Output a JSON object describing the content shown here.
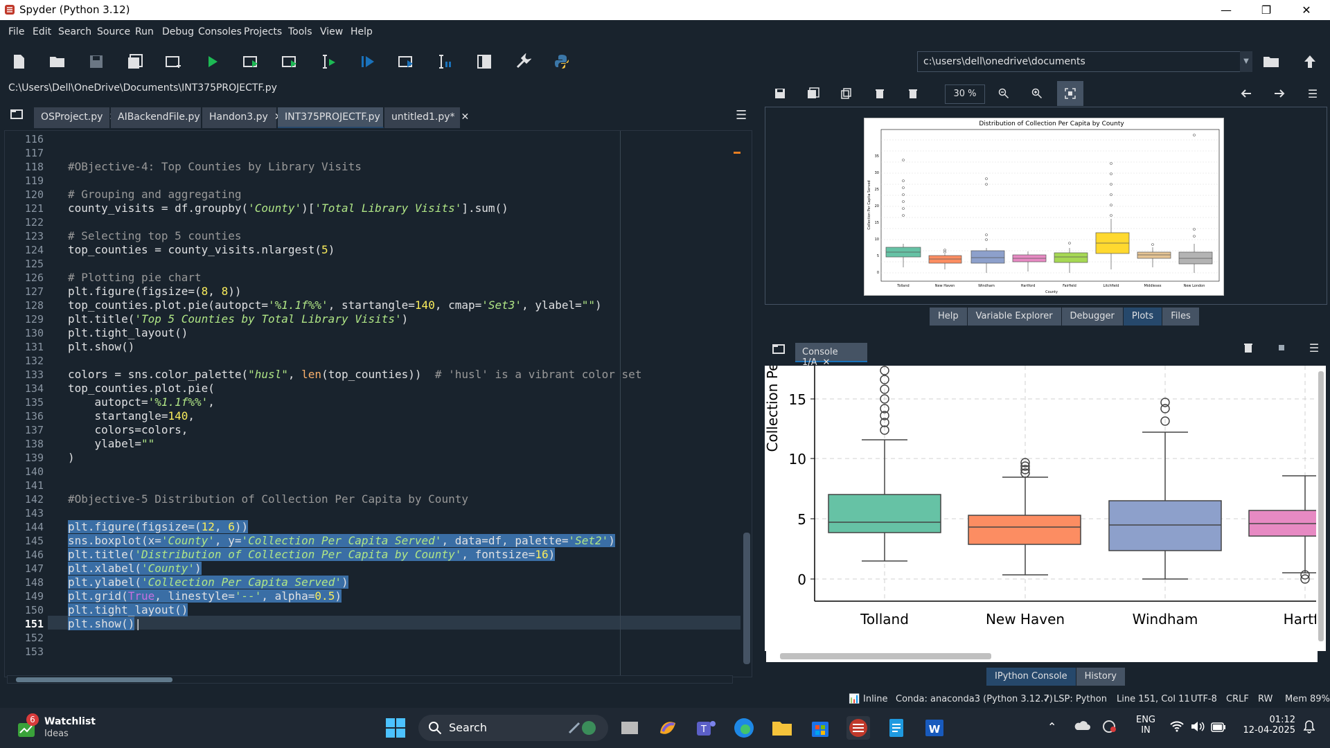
{
  "window": {
    "title": "Spyder (Python 3.12)"
  },
  "menu": [
    "File",
    "Edit",
    "Search",
    "Source",
    "Run",
    "Debug",
    "Consoles",
    "Projects",
    "Tools",
    "View",
    "Help"
  ],
  "toolbar": {
    "path_value": "c:\\users\\dell\\onedrive\\documents"
  },
  "editor": {
    "file_path": "C:\\Users\\Dell\\OneDrive\\Documents\\INT375PROJECTF.py",
    "tabs": [
      "OSProject.py",
      "AIBackendFile.py",
      "Handon3.py",
      "INT375PROJECTF.py",
      "untitled1.py*"
    ],
    "active_tab": 3,
    "line_numbers": [
      "116",
      "117",
      "118",
      "119",
      "120",
      "121",
      "122",
      "123",
      "124",
      "125",
      "126",
      "127",
      "128",
      "129",
      "130",
      "131",
      "132",
      "133",
      "134",
      "135",
      "136",
      "137",
      "138",
      "139",
      "140",
      "141",
      "142",
      "143",
      "144",
      "145",
      "146",
      "147",
      "148",
      "149",
      "150",
      "151",
      "152",
      "153"
    ],
    "current_line": "151"
  },
  "plots": {
    "zoom": "30 %",
    "tabs": [
      "Help",
      "Variable Explorer",
      "Debugger",
      "Plots",
      "Files"
    ],
    "active_tab": "Plots",
    "figure_title": "Distribution of Collection Per Capita by County",
    "x_label": "County",
    "y_label": "Collection Per Capita Served",
    "counties": [
      "Tolland",
      "New Haven",
      "Windham",
      "Hartford",
      "Fairfield",
      "Litchfield",
      "Middlesex",
      "New London"
    ],
    "y_ticks": [
      "0",
      "5",
      "10",
      "15",
      "20",
      "25",
      "30",
      "35"
    ]
  },
  "console": {
    "tab_label": "Console 1/A",
    "y_label": "Collection Pe",
    "y_ticks": [
      "0",
      "5",
      "10",
      "15"
    ],
    "x_ticks": [
      "Tolland",
      "New Haven",
      "Windham",
      "Hartfo"
    ],
    "bottom_tabs": [
      "IPython Console",
      "History"
    ]
  },
  "statusbar": {
    "inline": "Inline",
    "conda": "Conda: anaconda3 (Python 3.12.7)",
    "lsp": "✓ LSP: Python",
    "position": "Line 151, Col 11",
    "encoding": "UTF-8",
    "eol": "CRLF",
    "rw": "RW",
    "mem": "Mem 89%"
  },
  "taskbar": {
    "watchlist": "Watchlist",
    "watchlist_sub": "Ideas",
    "badge": "6",
    "search": "Search",
    "lang1": "ENG",
    "lang2": "IN",
    "time": "01:12",
    "date": "12-04-2025"
  },
  "colors": {
    "bg": "#19232d",
    "selection": "#3a6ea5",
    "accent": "#26486b"
  }
}
